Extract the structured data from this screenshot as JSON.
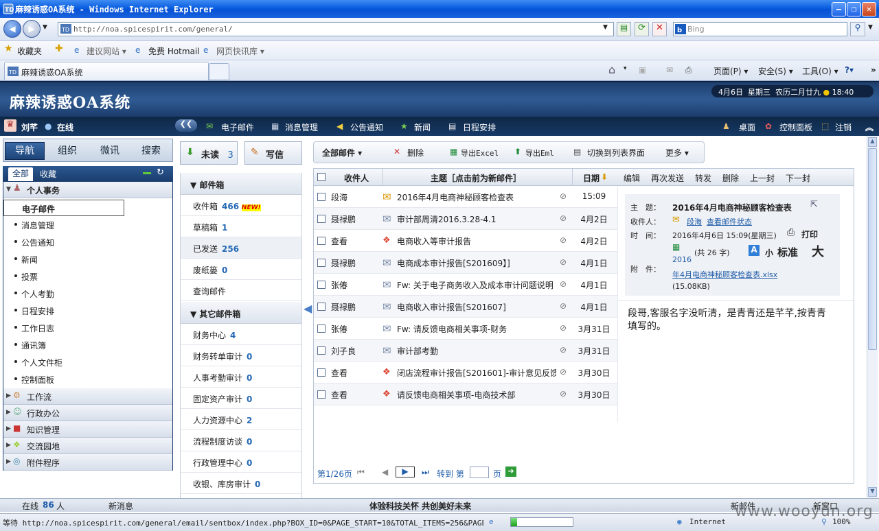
{
  "window": {
    "title": "麻辣诱惑OA系统 - Windows Internet Explorer"
  },
  "browser": {
    "url": "http://noa.spicespirit.com/general/",
    "search_placeholder": "Bing",
    "favorites": "收藏夹",
    "fav_suggest": "建议网站 ▾",
    "fav_hotmail": "免费 Hotmail",
    "fav_webslice": "网页快讯库 ▾",
    "tab_title": "麻辣诱惑OA系统",
    "cmd_page": "页面(P) ▾",
    "cmd_safety": "安全(S) ▾",
    "cmd_tools": "工具(O) ▾"
  },
  "oa": {
    "logo": "麻辣诱惑OA系统",
    "date": "4月6日",
    "weekday": "星期三",
    "lunar": "农历二月廿九",
    "time": "18:40"
  },
  "user": {
    "name": "刘芊",
    "status": "在线"
  },
  "topnav": {
    "items": [
      "电子邮件",
      "消息管理",
      "公告通知",
      "新闻",
      "日程安排"
    ],
    "desktop": "桌面",
    "control": "控制面板",
    "logout": "注销"
  },
  "left": {
    "tabs": [
      "导航",
      "组织",
      "微讯",
      "搜索"
    ],
    "subtabs": [
      "全部",
      "收藏"
    ],
    "group_personal": "个人事务",
    "items": [
      "电子邮件",
      "消息管理",
      "公告通知",
      "新闻",
      "投票",
      "个人考勤",
      "日程安排",
      "工作日志",
      "通讯簿",
      "个人文件柜",
      "控制面板"
    ],
    "groups": [
      "工作流",
      "行政办公",
      "知识管理",
      "交流园地",
      "附件程序"
    ]
  },
  "mid": {
    "unread_label": "未读",
    "unread_count": "3",
    "compose_label": "写信",
    "mailbox_head": "邮件箱",
    "inbox": "收件箱",
    "inbox_count": "466",
    "new_badge": "NEW!",
    "draft": "草稿箱",
    "draft_count": "1",
    "sent": "已发送",
    "sent_count": "256",
    "trash": "废纸篓",
    "trash_count": "0",
    "query": "查询邮件",
    "other_head": "其它邮件箱",
    "others": [
      {
        "name": "财务中心",
        "count": "4"
      },
      {
        "name": "财务转单审计",
        "count": "0"
      },
      {
        "name": "人事考勤审计",
        "count": "0"
      },
      {
        "name": "固定资产审计",
        "count": "0"
      },
      {
        "name": "人力资源中心",
        "count": "2"
      },
      {
        "name": "流程制度访谈",
        "count": "0"
      },
      {
        "name": "行政管理中心",
        "count": "0"
      },
      {
        "name": "收银、库房审计",
        "count": "0"
      }
    ]
  },
  "toolbar": {
    "all": "全部邮件 ▾",
    "delete": "删除",
    "excel": "导出Excel",
    "eml": "导出Eml",
    "switch": "切换到列表界面",
    "more": "更多 ▾"
  },
  "list": {
    "col_recipient": "收件人",
    "col_subject": "主题［点击前为新邮件］",
    "col_date": "日期",
    "rows": [
      {
        "to": "段海",
        "subject": "2016年4月电商神秘顾客检查表",
        "date": "15:09",
        "icon": "envelope-open"
      },
      {
        "to": "聂禄鹏",
        "subject": "审计部周清2016.3.28-4.1",
        "date": "4月2日",
        "icon": "envelope"
      },
      {
        "to": "查看",
        "subject": "电商收入等审计报告",
        "date": "4月2日",
        "icon": "gift"
      },
      {
        "to": "聂禄鹏",
        "subject": "电商成本审计报告[S201609】]",
        "date": "4月1日",
        "icon": "envelope"
      },
      {
        "to": "张偆",
        "subject": "Fw: 关于电子商务收入及成本审计问题说明",
        "date": "4月1日",
        "icon": "envelope"
      },
      {
        "to": "聂禄鹏",
        "subject": "电商收入审计报告[S201607]",
        "date": "4月1日",
        "icon": "envelope"
      },
      {
        "to": "张偆",
        "subject": "Fw: 请反馈电商相关事项-财务",
        "date": "3月31日",
        "icon": "envelope"
      },
      {
        "to": "刘子良",
        "subject": "审计部考勤",
        "date": "3月31日",
        "icon": "envelope"
      },
      {
        "to": "查看",
        "subject": "闭店流程审计报告[S201601]-审计意见反馈",
        "date": "3月30日",
        "icon": "gift"
      },
      {
        "to": "查看",
        "subject": "请反馈电商相关事项-电商技术部",
        "date": "3月30日",
        "icon": "gift"
      }
    ],
    "page": "第1/26页",
    "goto": "转到 第",
    "page_unit": "页"
  },
  "reader": {
    "actions": [
      "编辑",
      "再次发送",
      "转发",
      "删除",
      "上一封",
      "下一封"
    ],
    "subject_label": "主　题：",
    "subject": "2016年4月电商神秘顾客检查表",
    "to_label": "收件人：",
    "to": "段海",
    "check_status": "查看邮件状态",
    "time_label": "时　间：",
    "time": "2016年4月6日 15:09(星期三)",
    "print": "打印",
    "chars": "(共 26 字)",
    "size_small": "小",
    "size_std": "标准",
    "size_big": "大",
    "attach_label": "附　件：",
    "attach_year": "2016",
    "attach_name": "年4月电商神秘顾客检查表.xlsx",
    "attach_size": "(15.08KB)",
    "body": "段哥,客服名字没听清，是青青还是芊芊,按青青填写的。"
  },
  "status": {
    "online": "在线",
    "online_count": "86",
    "online_unit": "人",
    "newmsg": "新消息",
    "slogan": "体验科技关怀  共创美好未来",
    "newmail": "新邮件",
    "newwin": "新窗口"
  },
  "iestatus": {
    "text": "等待 http://noa.spicespirit.com/general/email/sentbox/index.php?BOX_ID=0&PAGE_START=10&TOTAL_ITEMS=256&PAGE_SIZE=10...",
    "zone": "Internet",
    "zoom": "100%",
    "progress": 0.1,
    "watermark": "www.wooyun.org"
  },
  "colors": {
    "xp_title": "#0a5ee0",
    "oa_header": "#1e3f6f",
    "accent_blue": "#2468b4"
  }
}
